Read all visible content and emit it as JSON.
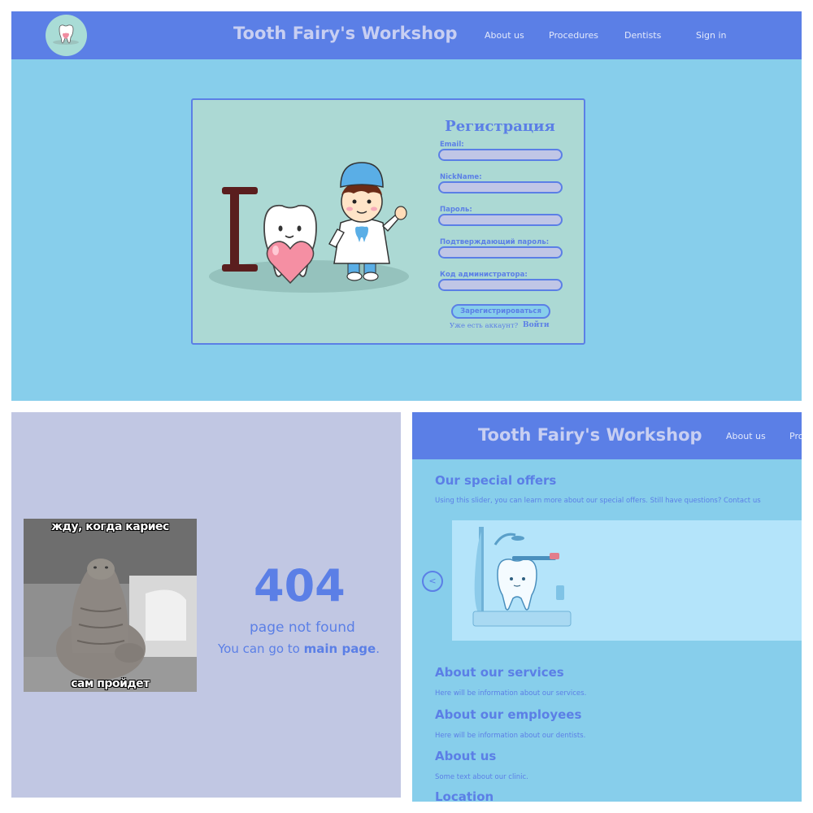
{
  "site": {
    "brand": "Tooth Fairy's Workshop"
  },
  "nav": {
    "about": "About us",
    "procedures": "Procedures",
    "dentists": "Dentists",
    "signin": "Sign in"
  },
  "registration": {
    "title": "Регистрация",
    "fields": [
      {
        "label": "Email:",
        "value": ""
      },
      {
        "label": "NickName:",
        "value": ""
      },
      {
        "label": "Пароль:",
        "value": ""
      },
      {
        "label": "Подтверждающий пароль:",
        "value": ""
      },
      {
        "label": "Код администратора:",
        "value": ""
      }
    ],
    "submit": "Зарегистрироваться",
    "have_account": "Уже есть аккаунт?",
    "login": "Войти"
  },
  "not_found": {
    "meme_top": "жду, когда кариес",
    "meme_bottom": "сам пройдет",
    "code": "404",
    "message": "page not found",
    "goto_prefix": "You can go to",
    "goto_link": "main page",
    "goto_suffix": "."
  },
  "home": {
    "nav_cut": "Pro",
    "offers_title": "Our special offers",
    "offers_text": "Using this slider, you can learn more about our special offers. Still have questions? Contact us",
    "slider_prev": "<",
    "services_title": "About our services",
    "services_text": "Here will be information about our services.",
    "employees_title": "About our employees",
    "employees_text": "Here will be information about our dentists.",
    "about_title": "About us",
    "about_text": "Some text about our clinic.",
    "location_title": "Location"
  },
  "colors": {
    "accent": "#5b7fe6",
    "sky": "#87ceeb",
    "card": "#acd9d4",
    "lavender": "#c1c7e3"
  }
}
